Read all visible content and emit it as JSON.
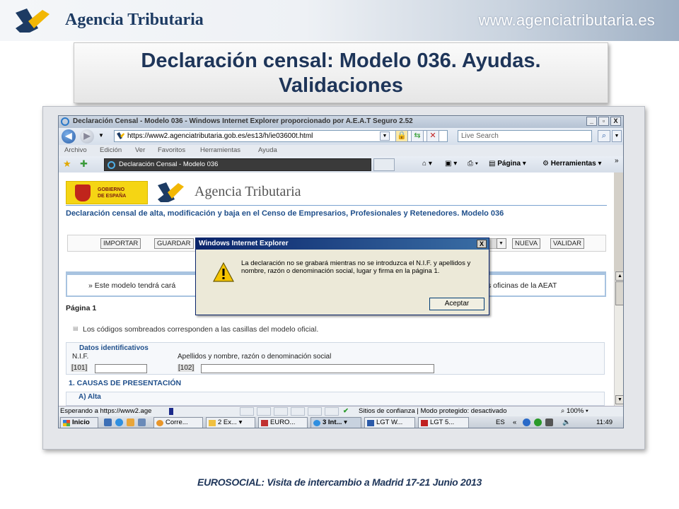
{
  "slide": {
    "brand_name": "Agencia Tributaria",
    "brand_url": "www.agenciatributaria.es",
    "title_line1": "Declaración censal: Modelo 036. Ayudas.",
    "title_line2": "Validaciones",
    "footer": "EUROSOCIAL: Visita de intercambio a Madrid 17-21 Junio 2013"
  },
  "browser": {
    "window_title": "Declaración Censal - Modelo 036 - Windows Internet Explorer proporcionado por A.E.A.T Seguro 2.52",
    "window_buttons": [
      "_",
      "▫",
      "X"
    ],
    "address": "https://www2.agenciatributaria.gob.es/es13/h/ie03600t.html",
    "search_placeholder": "Live Search",
    "menu": [
      "Archivo",
      "Edición",
      "Ver",
      "Favoritos",
      "Herramientas",
      "Ayuda"
    ],
    "tab_title": "Declaración Censal - Modelo 036",
    "command_pagina": "Página",
    "command_herramientas": "Herramientas",
    "status_text": "Esperando a https://www2.age",
    "trust_text": "Sitios de confianza | Modo protegido: desactivado",
    "zoom": "100%"
  },
  "page": {
    "gobierno_line1": "GOBIERNO",
    "gobierno_line2": "DE ESPAÑA",
    "at_name": "Agencia Tributaria",
    "heading": "Declaración censal de alta, modificación y baja en el Censo de Empresarios, Profesionales y Retenedores. Modelo 036",
    "toolbar_buttons": [
      "IMPORTAR",
      "GUARDAR",
      "NUEVA",
      "VALIDAR"
    ],
    "info_left": "»   Este modelo tendrá cará",
    "info_right": "s oficinas de la AEAT",
    "pagina": "Página 1",
    "note": "Los códigos sombreados corresponden a las casillas del modelo oficial.",
    "datos_title": "Datos identificativos",
    "nif_label": "N.I.F.",
    "name_label": "Apellidos y nombre, razón o denominación social",
    "code_101": "[101]",
    "code_102": "[102]",
    "causas": "1. CAUSAS DE PRESENTACIÓN",
    "alta": "A) Alta"
  },
  "dialog": {
    "title": "Windows Internet Explorer",
    "close": "X",
    "message": "La declaración no se grabará mientras no se introduzca el N.I.F. y apellidos y nombre, razón o denominación social, lugar y firma en la página 1.",
    "accept": "Aceptar"
  },
  "taskbar": {
    "start": "Inicio",
    "tasks": [
      "Corre...",
      "2 Ex...",
      "EURO...",
      "3 Int...",
      "LGT W...",
      "LGT 5..."
    ],
    "lang": "ES",
    "clock": "11:49"
  },
  "colors": {
    "title_blue": "#1e3559",
    "page_blue": "#1f4f8b",
    "dialog_title": "#0a246a"
  }
}
